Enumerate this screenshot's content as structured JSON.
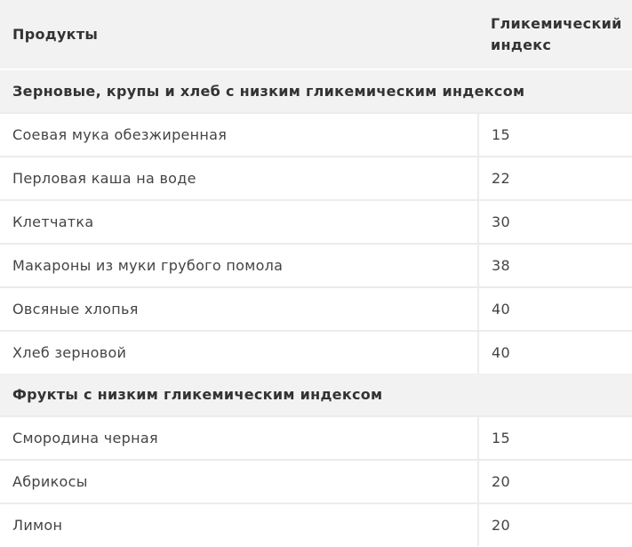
{
  "table": {
    "headers": [
      "Продукты",
      "Гликемический индекс"
    ],
    "sections": [
      {
        "title": "Зерновые, крупы и хлеб с низким гликемическим индексом",
        "rows": [
          {
            "product": "Соевая мука обезжиренная",
            "gi": "15"
          },
          {
            "product": "Перловая каша на воде",
            "gi": "22"
          },
          {
            "product": "Клетчатка",
            "gi": "30"
          },
          {
            "product": "Макароны из муки грубого помола",
            "gi": "38"
          },
          {
            "product": "Овсяные хлопья",
            "gi": "40"
          },
          {
            "product": "Хлеб зерновой",
            "gi": "40"
          }
        ]
      },
      {
        "title": "Фрукты с низким гликемическим индексом",
        "rows": [
          {
            "product": "Смородина черная",
            "gi": "15"
          },
          {
            "product": "Абрикосы",
            "gi": "20"
          },
          {
            "product": "Лимон",
            "gi": "20"
          }
        ]
      }
    ]
  }
}
